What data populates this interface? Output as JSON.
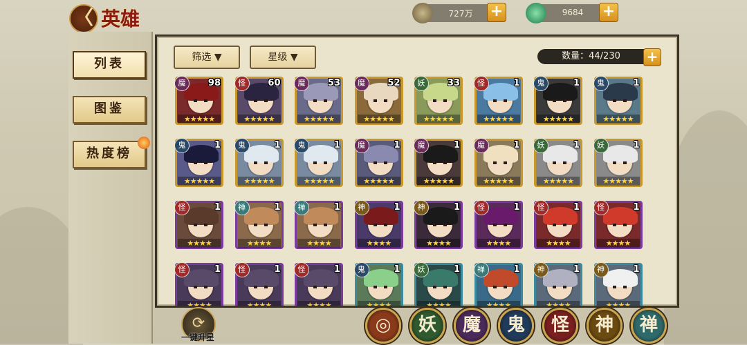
{
  "header": {
    "back_glyph": "〈",
    "title": "英雄"
  },
  "resources": {
    "coins": "727万",
    "jade": "9684",
    "plus": "+"
  },
  "sidebar": {
    "items": [
      {
        "label": "列表"
      },
      {
        "label": "图鉴"
      },
      {
        "label": "热度榜"
      }
    ]
  },
  "panel": {
    "filter_label": "筛选 ▼",
    "star_label": "星级 ▼",
    "count_label": "数量：44/230",
    "count_plus": "+"
  },
  "heroes": [
    {
      "faction": "魔",
      "level": "98",
      "stars": "★★★★★",
      "color": "#7a2a2a",
      "hair": "#8a1a1a",
      "badge": "#6a2a5a"
    },
    {
      "faction": "怪",
      "level": "60",
      "stars": "★★★★★",
      "color": "#5a4a6a",
      "hair": "#2a2440",
      "badge": "#a02a2a"
    },
    {
      "faction": "魔",
      "level": "53",
      "stars": "★★★★★",
      "color": "#6a6a8a",
      "hair": "#9a9ab8",
      "badge": "#6a2a5a"
    },
    {
      "faction": "魔",
      "level": "52",
      "stars": "★★★★★",
      "color": "#8a6a3a",
      "hair": "#e8d8c0",
      "badge": "#6a2a5a"
    },
    {
      "faction": "妖",
      "level": "33",
      "stars": "★★★★★",
      "color": "#8a9a5a",
      "hair": "#c8d88a",
      "badge": "#3a6a3a"
    },
    {
      "faction": "怪",
      "level": "1",
      "stars": "★★★★★",
      "color": "#4a7aa0",
      "hair": "#8ac0e8",
      "badge": "#a02a2a"
    },
    {
      "faction": "鬼",
      "level": "1",
      "stars": "★★★★★",
      "color": "#3a3a3a",
      "hair": "#1a1a1a",
      "badge": "#2a4a6a"
    },
    {
      "faction": "鬼",
      "level": "1",
      "stars": "★★★★★",
      "color": "#5a7a8a",
      "hair": "#2a3a4a",
      "badge": "#2a4a6a"
    },
    {
      "faction": "鬼",
      "level": "1",
      "stars": "★★★★★",
      "color": "#5a5a8a",
      "hair": "#1a1a3a",
      "badge": "#2a4a6a"
    },
    {
      "faction": "鬼",
      "level": "1",
      "stars": "★★★★★",
      "color": "#7a8aa0",
      "hair": "#e0e8f0",
      "badge": "#2a4a6a"
    },
    {
      "faction": "鬼",
      "level": "1",
      "stars": "★★★★★",
      "color": "#7a8aa0",
      "hair": "#e0e8f0",
      "badge": "#2a4a6a"
    },
    {
      "faction": "魔",
      "level": "1",
      "stars": "★★★★★",
      "color": "#5a5a7a",
      "hair": "#8a8ab0",
      "badge": "#6a2a5a"
    },
    {
      "faction": "魔",
      "level": "1",
      "stars": "★★★★★",
      "color": "#4a3a3a",
      "hair": "#1a1a1a",
      "badge": "#6a2a5a"
    },
    {
      "faction": "魔",
      "level": "1",
      "stars": "★★★★★",
      "color": "#8a7a5a",
      "hair": "#f0e0c0",
      "badge": "#6a2a5a"
    },
    {
      "faction": "妖",
      "level": "1",
      "stars": "★★★★★",
      "color": "#8a8a8a",
      "hair": "#e8e8e8",
      "badge": "#3a6a3a"
    },
    {
      "faction": "妖",
      "level": "1",
      "stars": "★★★★★",
      "color": "#8a8a8a",
      "hair": "#e8e8e8",
      "badge": "#3a6a3a"
    },
    {
      "faction": "怪",
      "level": "1",
      "stars": "★★★★",
      "color": "#6a4a3a",
      "hair": "#5a3a2a",
      "badge": "#a02a2a"
    },
    {
      "faction": "禅",
      "level": "1",
      "stars": "★★★★",
      "color": "#8a6a4a",
      "hair": "#c08a5a",
      "badge": "#3a7a7a"
    },
    {
      "faction": "禅",
      "level": "1",
      "stars": "★★★★",
      "color": "#8a6a4a",
      "hair": "#c08a5a",
      "badge": "#3a7a7a"
    },
    {
      "faction": "神",
      "level": "1",
      "stars": "★★★★",
      "color": "#4a3a6a",
      "hair": "#7a1a1a",
      "badge": "#7a5a1a"
    },
    {
      "faction": "神",
      "level": "1",
      "stars": "★★★★",
      "color": "#3a2a3a",
      "hair": "#1a1a1a",
      "badge": "#7a5a1a"
    },
    {
      "faction": "怪",
      "level": "1",
      "stars": "★★★★",
      "color": "#5a2a5a",
      "hair": "#6a1a6a",
      "badge": "#a02a2a"
    },
    {
      "faction": "怪",
      "level": "1",
      "stars": "★★★★",
      "color": "#7a2a2a",
      "hair": "#d03a2a",
      "badge": "#a02a2a"
    },
    {
      "faction": "怪",
      "level": "1",
      "stars": "★★★★",
      "color": "#7a2a2a",
      "hair": "#d03a2a",
      "badge": "#a02a2a"
    },
    {
      "faction": "怪",
      "level": "1",
      "stars": "★★★★",
      "color": "#4a3a5a",
      "hair": "#5a4a6a",
      "badge": "#a02a2a"
    },
    {
      "faction": "怪",
      "level": "1",
      "stars": "★★★★",
      "color": "#4a3a5a",
      "hair": "#5a4a6a",
      "badge": "#a02a2a"
    },
    {
      "faction": "怪",
      "level": "1",
      "stars": "★★★★",
      "color": "#4a3a5a",
      "hair": "#5a4a6a",
      "badge": "#a02a2a"
    },
    {
      "faction": "鬼",
      "level": "1",
      "stars": "★★★★",
      "color": "#5a7a5a",
      "hair": "#8ad08a",
      "badge": "#2a4a6a"
    },
    {
      "faction": "妖",
      "level": "1",
      "stars": "★★★★",
      "color": "#2a4a4a",
      "hair": "#3a7a6a",
      "badge": "#3a6a3a"
    },
    {
      "faction": "禅",
      "level": "1",
      "stars": "★★★★",
      "color": "#3a6a8a",
      "hair": "#c04a2a",
      "badge": "#3a7a7a"
    },
    {
      "faction": "神",
      "level": "1",
      "stars": "★★★★",
      "color": "#5a6a7a",
      "hair": "#b0b0c0",
      "badge": "#7a5a1a"
    },
    {
      "faction": "神",
      "level": "1",
      "stars": "★★★★",
      "color": "#5a6a7a",
      "hair": "#f0f0f0",
      "badge": "#7a5a1a"
    }
  ],
  "bottom": {
    "upgrade_glyph": "⟳",
    "upgrade_label": "一键升星",
    "categories": [
      {
        "label": "◎",
        "bg": "#8a3a1a"
      },
      {
        "label": "妖",
        "bg": "#2f5a2f"
      },
      {
        "label": "魔",
        "bg": "#4a2a5a"
      },
      {
        "label": "鬼",
        "bg": "#1f3a5a"
      },
      {
        "label": "怪",
        "bg": "#7a1f1f"
      },
      {
        "label": "神",
        "bg": "#6a4a10"
      },
      {
        "label": "禅",
        "bg": "#2f6a6a"
      }
    ]
  }
}
